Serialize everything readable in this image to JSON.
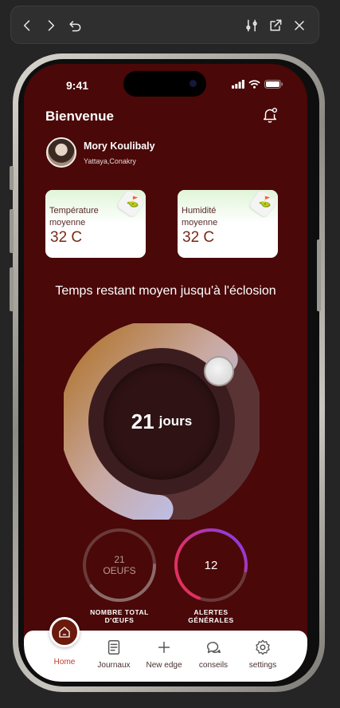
{
  "toolbar": {
    "icons": [
      "back-arrow",
      "forward-arrow",
      "reload",
      "sliders",
      "open-external",
      "close"
    ]
  },
  "status_bar": {
    "time": "9:41"
  },
  "header": {
    "greeting": "Bienvenue"
  },
  "user": {
    "name": "Mory Koulibaly",
    "location": "Yattaya,Conakry"
  },
  "cards": [
    {
      "label": "Température moyenne",
      "value": "32 C"
    },
    {
      "label": "Humidité moyenne",
      "value": "32 C"
    }
  ],
  "countdown": {
    "title": "Temps restant moyen jusqu'à l'éclosion",
    "number": "21",
    "unit": "jours",
    "progress": 0.62
  },
  "stats": [
    {
      "line1": "21",
      "line2": "OEUFS",
      "caption": "NOMBRE TOTAL D'ŒUFS",
      "progress": 0.4
    },
    {
      "value": "12",
      "caption": "ALERTES GÉNÉRALES",
      "progress": 0.72
    }
  ],
  "tabbar": {
    "items": [
      {
        "label": "Home"
      },
      {
        "label": "Journaux"
      },
      {
        "label": "New edge"
      },
      {
        "label": "conseils"
      },
      {
        "label": "settings"
      }
    ]
  },
  "colors": {
    "screen_bg": "#4a0808",
    "active_tab": "#c0392b",
    "home_bubble": "#6b1a0c"
  }
}
